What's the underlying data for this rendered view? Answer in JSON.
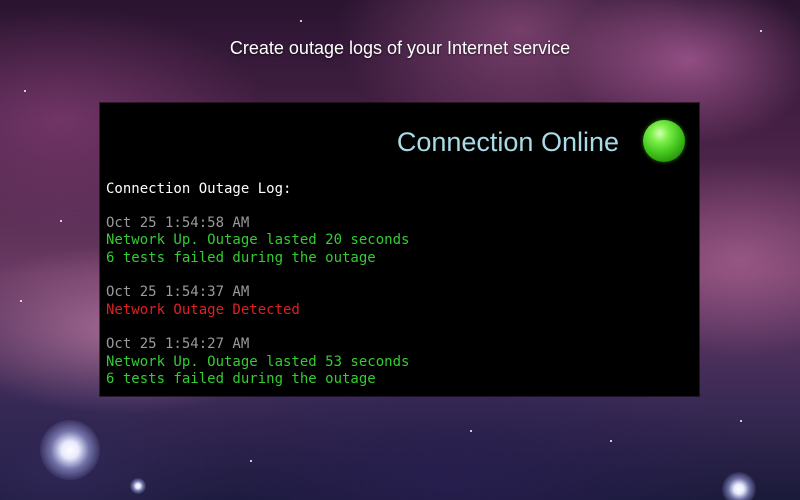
{
  "headline": "Create outage logs of your Internet service",
  "status": {
    "text": "Connection Online",
    "indicator_icon": "green-status-light-icon",
    "indicator_color": "#4cd322"
  },
  "log": {
    "title": "Connection Outage Log:",
    "entries": [
      {
        "timestamp": "Oct 25 1:54:58 AM",
        "message": "Network Up. Outage lasted 20 seconds",
        "detail": "6 tests failed during the outage"
      },
      {
        "timestamp": "Oct 25 1:54:37 AM",
        "message": "Network Outage Detected"
      },
      {
        "timestamp": "Oct 25 1:54:27 AM",
        "message": "Network Up. Outage lasted 53 seconds",
        "detail": "6 tests failed during the outage"
      }
    ]
  },
  "colors": {
    "ok": "#33cc33",
    "error": "#e02020",
    "timestamp": "#9a9a9a",
    "status_text": "#a8dbe6"
  }
}
